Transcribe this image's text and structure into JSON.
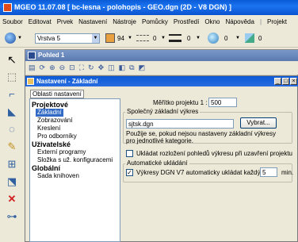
{
  "window": {
    "title": "MGEO 11.07.08 [ bc-lesna - polohopis - GEO.dgn (2D - V8 DGN) ]"
  },
  "menu": [
    "Soubor",
    "Editovat",
    "Prvek",
    "Nastavení",
    "Nástroje",
    "Pomůcky",
    "Prostředí",
    "Okno",
    "Nápověda",
    "|",
    "Projekt"
  ],
  "toolbar": {
    "level": "Vrstva 5",
    "color": "94",
    "style": "0",
    "weight": "0",
    "transparency": "0",
    "priority": "0",
    "colors": {
      "accent": "#e8a040"
    }
  },
  "view": {
    "title": "Pohled 1"
  },
  "dialog": {
    "title": "Nastavení - Základní",
    "tree_header": "Oblasti nastavení",
    "tree": [
      {
        "label": "Projektové",
        "bold": true
      },
      {
        "label": "Základní",
        "selected": true
      },
      {
        "label": "Zobrazování"
      },
      {
        "label": "Kreslení"
      },
      {
        "label": "Pro odborníky"
      },
      {
        "label": "Uživatelské",
        "bold": true
      },
      {
        "label": "Externí programy"
      },
      {
        "label": "Složka s už. konfiguracemi"
      },
      {
        "label": "Globální",
        "bold": true
      },
      {
        "label": "Sada knihoven"
      }
    ],
    "scale_label": "Měřítko projektu 1 :",
    "scale_value": "500",
    "group1_label": "Společný základní výkres",
    "base_file": "sjtsk.dgn",
    "browse_label": "Vybrat...",
    "group1_note": "Použije se, pokud nejsou nastaveny základní výkresy pro jednotlivé kategorie.",
    "save_layout_label": "Ukládat rozložení pohledů výkresu při uzavření projektu",
    "save_layout_checked": false,
    "group2_label": "Automatické ukládání",
    "autosave_label": "Výkresy DGN V7 automaticky ukládat každých",
    "autosave_checked": true,
    "autosave_value": "5",
    "autosave_unit": "min."
  }
}
